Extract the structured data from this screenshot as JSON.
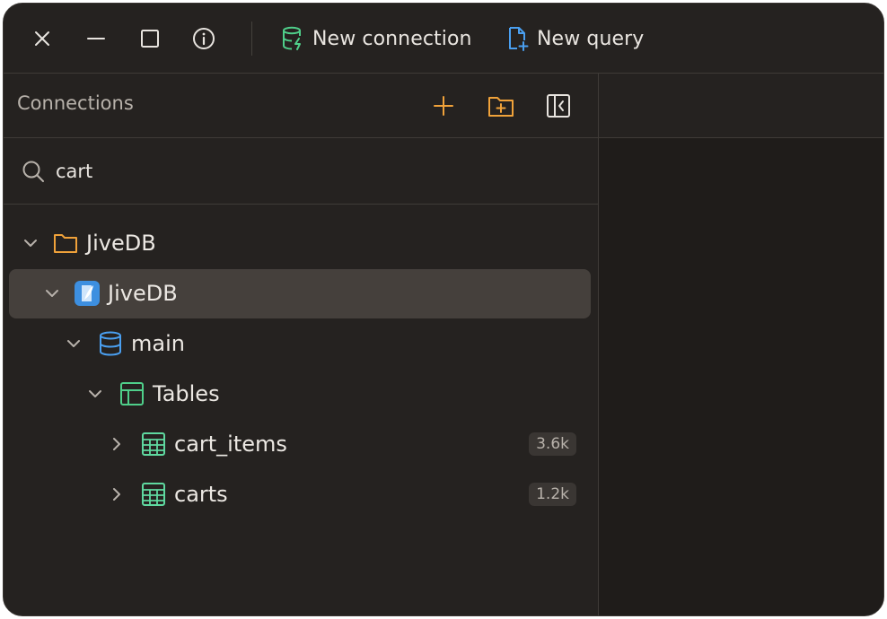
{
  "titlebar": {
    "close_icon": "close-icon",
    "minimize_icon": "minimize-icon",
    "maximize_icon": "maximize-icon",
    "info_icon": "info-icon",
    "new_connection_label": "New connection",
    "new_query_label": "New query"
  },
  "sidebar": {
    "title": "Connections",
    "add_icon": "plus-icon",
    "new_folder_icon": "folder-plus-icon",
    "collapse_icon": "collapse-sidebar-icon",
    "search": {
      "value": "cart",
      "placeholder": ""
    },
    "tree": [
      {
        "level": 0,
        "type": "folder",
        "label": "JiveDB",
        "expanded": true,
        "selected": false
      },
      {
        "level": 1,
        "type": "connection",
        "label": "JiveDB",
        "expanded": true,
        "selected": true
      },
      {
        "level": 2,
        "type": "database",
        "label": "main",
        "expanded": true,
        "selected": false
      },
      {
        "level": 3,
        "type": "group",
        "label": "Tables",
        "expanded": true,
        "selected": false
      },
      {
        "level": 4,
        "type": "table",
        "label": "cart_items",
        "expanded": false,
        "selected": false,
        "count": "3.6k"
      },
      {
        "level": 4,
        "type": "table",
        "label": "carts",
        "expanded": false,
        "selected": false,
        "count": "1.2k"
      }
    ]
  },
  "colors": {
    "background": "#252220",
    "accent_orange": "#f0a23a",
    "accent_green": "#4fcf8a",
    "accent_blue": "#4a9ff0",
    "text": "#ece8e3",
    "selected_row": "#45403c"
  }
}
